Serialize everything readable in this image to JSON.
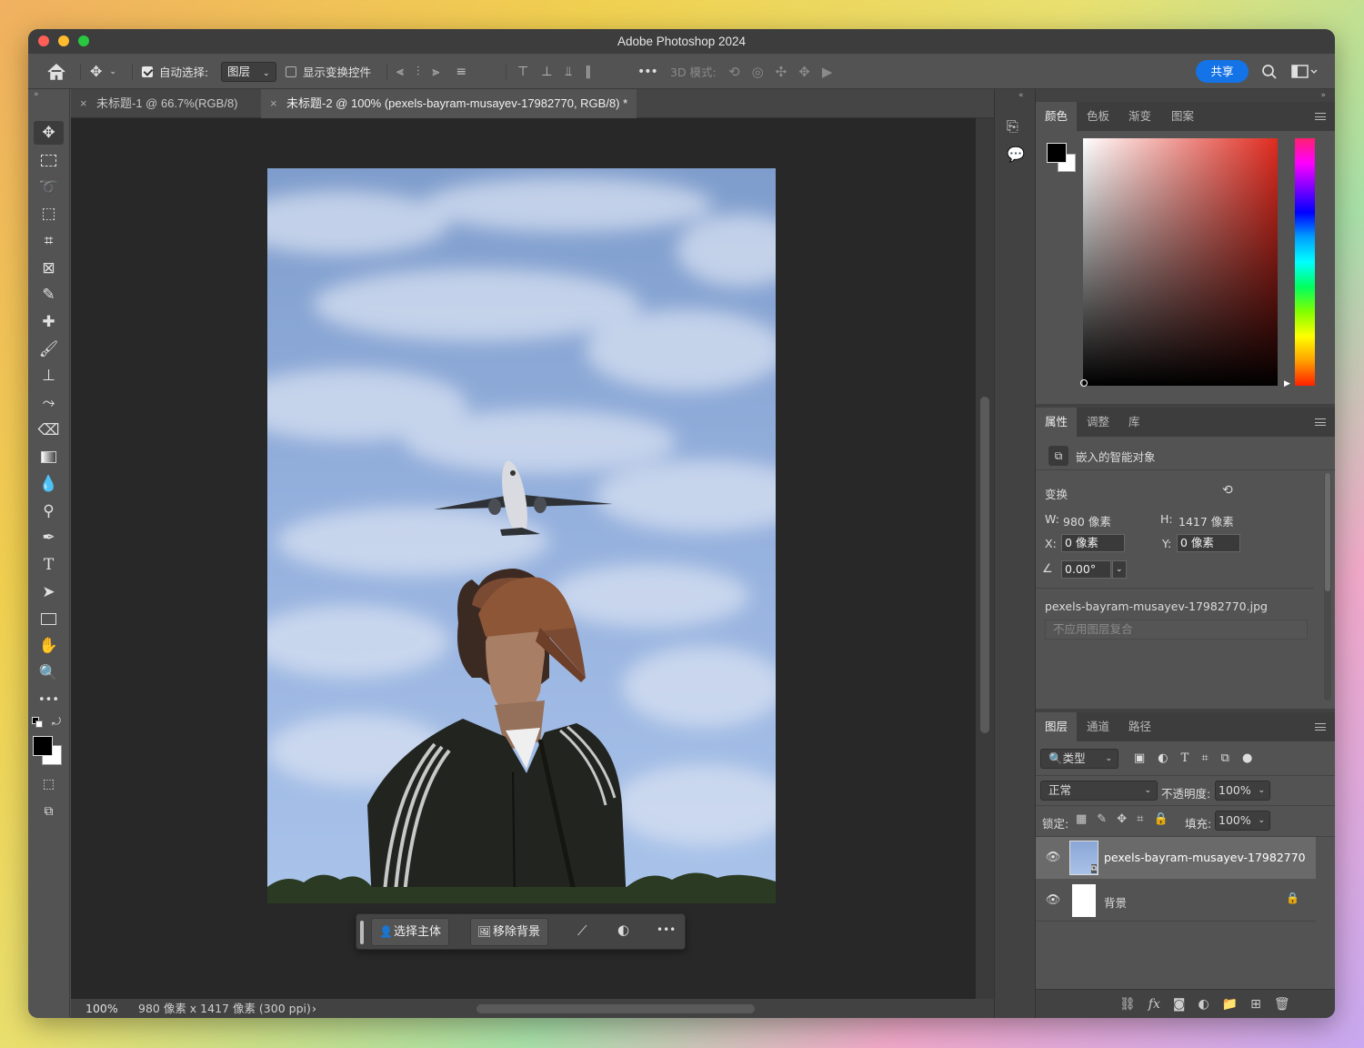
{
  "app": {
    "title": "Adobe Photoshop 2024"
  },
  "options": {
    "auto_select_label": "自动选择:",
    "auto_select_value": "图层",
    "show_transform_label": "显示变换控件",
    "mode_3d_label": "3D 模式:",
    "more": "•••",
    "share_label": "共享"
  },
  "tabs": [
    {
      "label": "未标题-1 @ 66.7%(RGB/8)",
      "active": false
    },
    {
      "label": "未标题-2 @ 100% (pexels-bayram-musayev-17982770, RGB/8) *",
      "active": true
    }
  ],
  "status": {
    "zoom": "100%",
    "doc_info": "980 像素 x 1417 像素 (300 ppi)",
    "arrow": "›"
  },
  "contextual_toolbar": {
    "select_subject": "选择主体",
    "remove_background": "移除背景",
    "more": "•••"
  },
  "color_panel": {
    "tabs": [
      "颜色",
      "色板",
      "渐变",
      "图案"
    ],
    "foreground": "#000000",
    "background": "#ffffff",
    "hue_color": "#e02b1f"
  },
  "properties_panel": {
    "tabs": [
      "属性",
      "调整",
      "库"
    ],
    "object_type": "嵌入的智能对象",
    "transform_label": "变换",
    "w_label": "W:",
    "w_value": "980 像素",
    "h_label": "H:",
    "h_value": "1417 像素",
    "x_label": "X:",
    "x_value": "0 像素",
    "y_label": "Y:",
    "y_value": "0 像素",
    "angle_value": "0.00°",
    "filename": "pexels-bayram-musayev-17982770.jpg",
    "layer_comp_placeholder": "不应用图层复合"
  },
  "layers_panel": {
    "tabs": [
      "图层",
      "通道",
      "路径"
    ],
    "filter_label": "类型",
    "blend_mode": "正常",
    "opacity_label": "不透明度:",
    "opacity_value": "100%",
    "lock_label": "锁定:",
    "fill_label": "填充:",
    "fill_value": "100%",
    "layers": [
      {
        "name": "pexels-bayram-musayev-17982770",
        "selected": true,
        "visible": true
      },
      {
        "name": "背景",
        "selected": false,
        "visible": true,
        "locked": true
      }
    ],
    "footer_fx": "fx"
  }
}
